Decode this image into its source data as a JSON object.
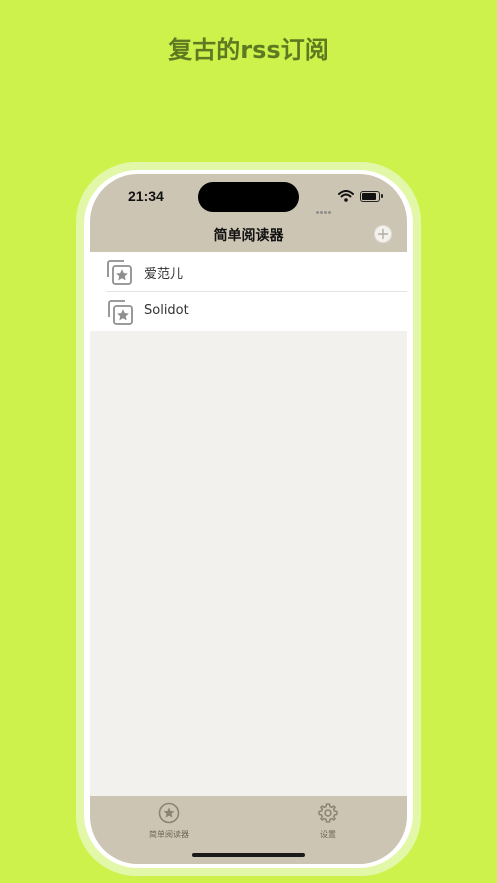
{
  "promo": {
    "headline": "复古的rss订阅"
  },
  "status_bar": {
    "time": "21:34"
  },
  "nav": {
    "title": "简单阅读器",
    "add_icon": "plus-circle-icon"
  },
  "feeds": [
    {
      "label": "爱范儿",
      "icon": "starred-stack-icon"
    },
    {
      "label": "Solidot",
      "icon": "starred-stack-icon"
    }
  ],
  "tabbar": {
    "tabs": [
      {
        "label": "简单阅读器",
        "icon": "star-circle-icon",
        "selected": true
      },
      {
        "label": "设置",
        "icon": "gear-icon",
        "selected": false
      }
    ]
  },
  "colors": {
    "background": "#cdf24c",
    "headline": "#5e7a21",
    "bars": "#cdc5b4",
    "content": "#f2f1ee"
  }
}
